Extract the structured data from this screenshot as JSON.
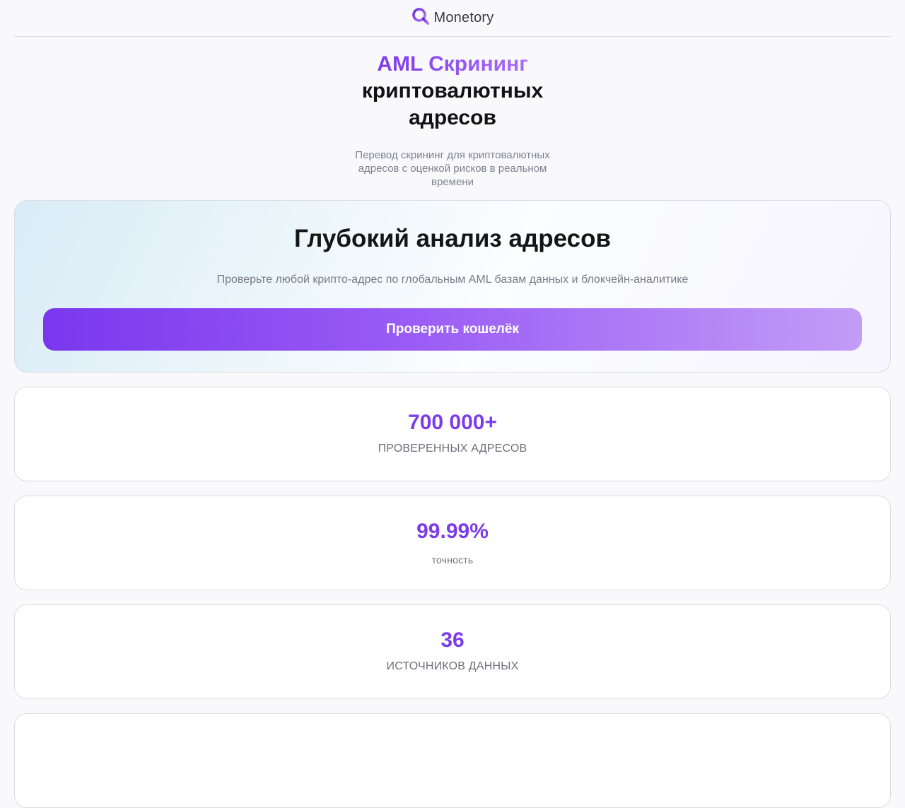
{
  "header": {
    "brand": "Monetory",
    "logo_icon": "magnifier-logo-icon"
  },
  "hero": {
    "title_accent": "AML Скрининг",
    "title_line2": "криптовалютных",
    "title_line3": "адресов",
    "subtitle": "Перевод скрининг для криптовалютных адресов с оценкой рисков в реальном времени"
  },
  "feature": {
    "title": "Глубокий анализ адресов",
    "description": "Проверьте любой крипто-адрес по глобальным AML базам данных и блокчейн-аналитике",
    "button_label": "Проверить кошелёк"
  },
  "stats": [
    {
      "value": "700 000+",
      "label": "ПРОВЕРЕННЫХ АДРЕСОВ"
    },
    {
      "value": "99.99%",
      "label": "точность"
    },
    {
      "value": "36",
      "label": "ИСТОЧНИКОВ ДАННЫХ"
    }
  ],
  "colors": {
    "accent": "#7c3aed",
    "accent_light": "#c29cf7",
    "muted_text": "#808090"
  }
}
